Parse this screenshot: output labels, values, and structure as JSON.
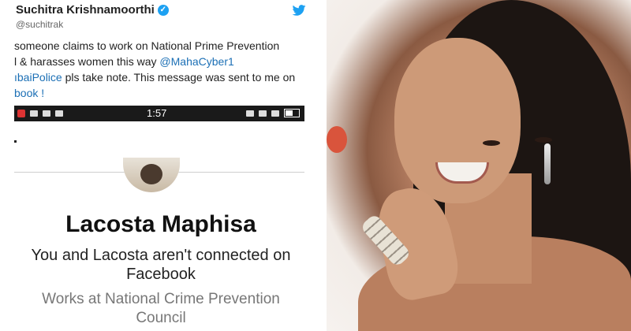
{
  "tweet": {
    "author": "Suchitra Krishnamoorthi",
    "handle": "@suchitrak",
    "lines": [
      "someone claims to work on National Prime Prevention",
      "l & harasses women this way ",
      "ıbaiPolice pls take note. This message was sent to me on",
      "book !"
    ],
    "mention": "@MahaCyber1",
    "icons": {
      "verified": "verified-badge-icon",
      "brand": "twitter-bird-icon"
    }
  },
  "phone": {
    "time": "1:57",
    "icons": [
      "signal-icon",
      "wifi-icon",
      "eye-icon",
      "battery-icon"
    ]
  },
  "profile": {
    "name": "Lacosta Maphisa",
    "connection_line1": "You and Lacosta aren't connected on",
    "connection_line2": "Facebook",
    "works_line1": "Works at National Crime Prevention",
    "works_line2": "Council"
  },
  "colors": {
    "twitter_blue": "#1da1f2",
    "link_blue": "#1b6fb5",
    "statusbar": "#1a1a1a"
  }
}
